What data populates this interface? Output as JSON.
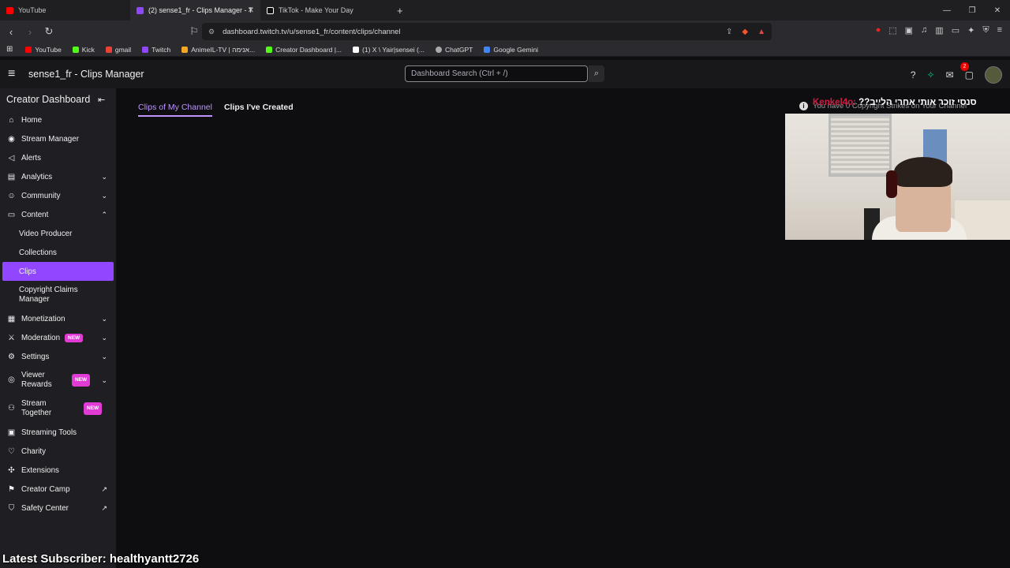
{
  "browser": {
    "tabs": [
      {
        "title": "YouTube",
        "color": "#ff0000"
      },
      {
        "title": "(2) sense1_fr - Clips Manager - T",
        "color": "#9147ff"
      },
      {
        "title": "TikTok - Make Your Day",
        "color": "#ffffff"
      }
    ],
    "new_tab": "+",
    "url": "dashboard.twitch.tv/u/sense1_fr/content/clips/channel",
    "bookmarks": [
      {
        "label": "YouTube",
        "color": "#ff0000"
      },
      {
        "label": "Kick",
        "color": "#53fc18"
      },
      {
        "label": "gmail",
        "color": "#ea4335"
      },
      {
        "label": "Twitch",
        "color": "#9147ff"
      },
      {
        "label": "AnimeIL-TV | אנימה...",
        "color": "#f5a623"
      },
      {
        "label": "Creator Dashboard |...",
        "color": "#53fc18"
      },
      {
        "label": "(1) X \\ Yair|sensei (...",
        "color": "#ffffff"
      },
      {
        "label": "ChatGPT",
        "color": "#aaaaaa"
      },
      {
        "label": "Google Gemini",
        "color": "#4285f4"
      }
    ]
  },
  "header": {
    "title": "sense1_fr - Clips Manager",
    "search_placeholder": "Dashboard Search (Ctrl + /)",
    "notification_count": "2"
  },
  "sidebar": {
    "heading": "Creator Dashboard",
    "items": [
      {
        "label": "Home",
        "icon": "home-icon"
      },
      {
        "label": "Stream Manager",
        "icon": "broadcast-icon"
      },
      {
        "label": "Alerts",
        "icon": "megaphone-icon"
      },
      {
        "label": "Analytics",
        "icon": "chart-icon"
      },
      {
        "label": "Community",
        "icon": "people-icon"
      },
      {
        "label": "Content",
        "icon": "content-icon"
      },
      {
        "label": "Video Producer"
      },
      {
        "label": "Collections"
      },
      {
        "label": "Clips"
      },
      {
        "label": "Copyright Claims Manager"
      },
      {
        "label": "Monetization",
        "icon": "money-icon"
      },
      {
        "label": "Moderation",
        "icon": "sword-icon",
        "badge": "NEW"
      },
      {
        "label": "Settings",
        "icon": "settings-icon"
      },
      {
        "label": "Viewer Rewards",
        "icon": "rewards-icon",
        "badge": "NEW"
      },
      {
        "label": "Stream Together",
        "icon": "together-icon",
        "badge": "NEW"
      },
      {
        "label": "Streaming Tools",
        "icon": "tools-icon"
      },
      {
        "label": "Charity",
        "icon": "heart-icon"
      },
      {
        "label": "Extensions",
        "icon": "puzzle-icon"
      },
      {
        "label": "Creator Camp",
        "icon": "external-link-icon"
      },
      {
        "label": "Safety Center",
        "icon": "external-link-icon"
      }
    ]
  },
  "main": {
    "tabs": [
      "Clips of My Channel",
      "Clips I've Created"
    ]
  },
  "overlay": {
    "chat_text": "??סנסי זוכר אותי אחרי הלייב",
    "chat_user": "Kenkel4o:",
    "notice": "You have 0 Copyright Strikes on Your Channel",
    "latest_subscriber": "Latest Subscriber: healthyantt2726"
  },
  "colors": {
    "accent": "#9147ff",
    "accent_text": "#bf94ff",
    "new_badge": "#e13bd5"
  }
}
